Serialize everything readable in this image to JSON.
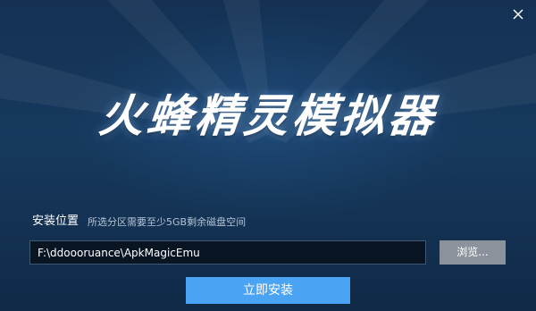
{
  "window": {
    "title": "火蜂精灵模拟器",
    "close_icon": "close-icon"
  },
  "install": {
    "location_label": "安装位置",
    "space_hint": "所选分区需要至少5GB剩余磁盘空间",
    "path_value": "F:\\ddoooruance\\ApkMagicEmu",
    "browse_label": "浏览...",
    "install_label": "立即安装"
  },
  "colors": {
    "background": "#163657",
    "accent": "#4ba3f3",
    "browse_button": "#8b929b",
    "input_background": "#0a1524"
  }
}
